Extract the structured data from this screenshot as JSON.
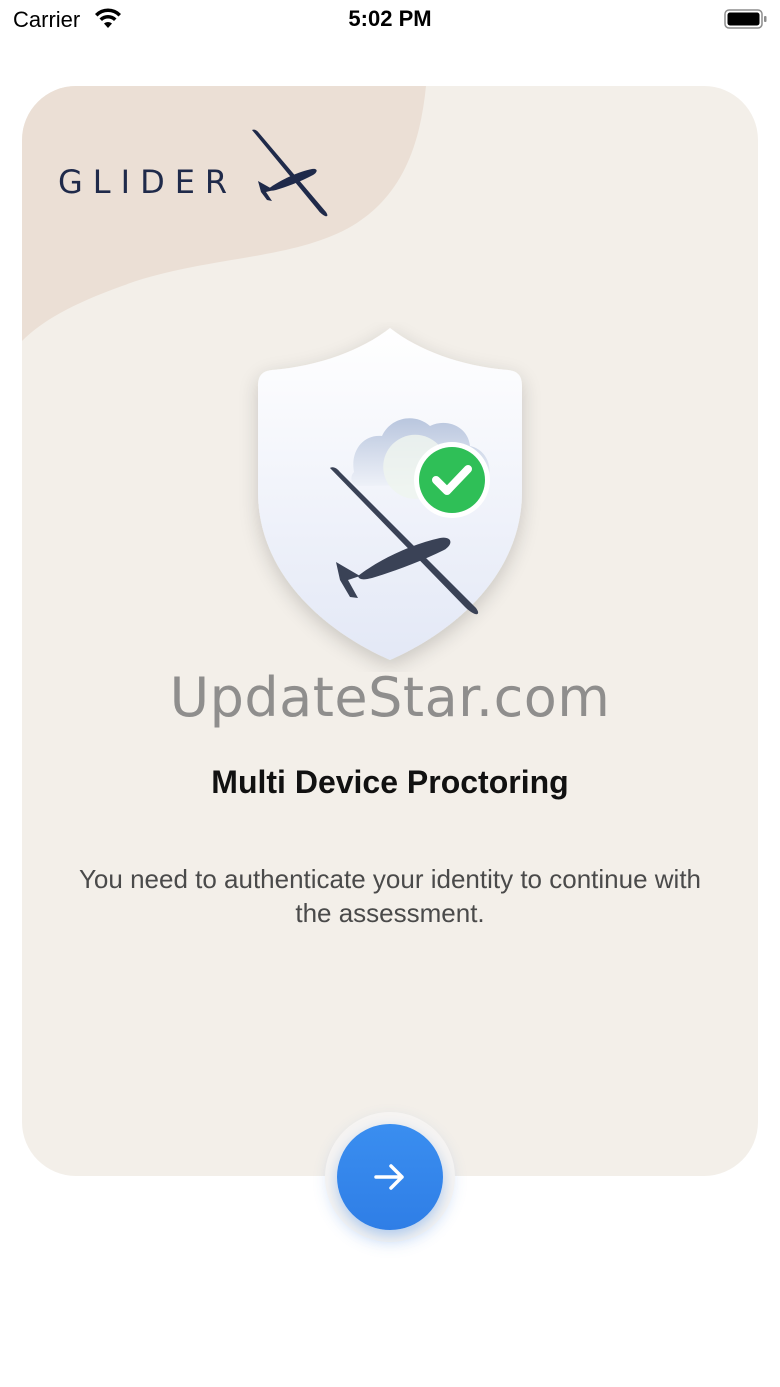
{
  "status_bar": {
    "carrier": "Carrier",
    "time": "5:02 PM",
    "wifi_icon": "wifi-icon",
    "battery_icon": "battery-icon"
  },
  "logo": {
    "text": "GLIDER",
    "icon": "glider-plane-icon"
  },
  "hero": {
    "icon": "shield-check-glider-icon"
  },
  "watermark": "UpdateStar.com",
  "title": "Multi Device Proctoring",
  "description": "You need to authenticate your identity to continue with the assessment.",
  "next_button": {
    "icon": "arrow-right-icon"
  },
  "colors": {
    "card_background": "#f3efe9",
    "card_wave": "#ebdfd5",
    "logo_navy": "#1f2a4a",
    "accent_blue": "#2f7ee6",
    "check_green": "#2fbf57"
  }
}
